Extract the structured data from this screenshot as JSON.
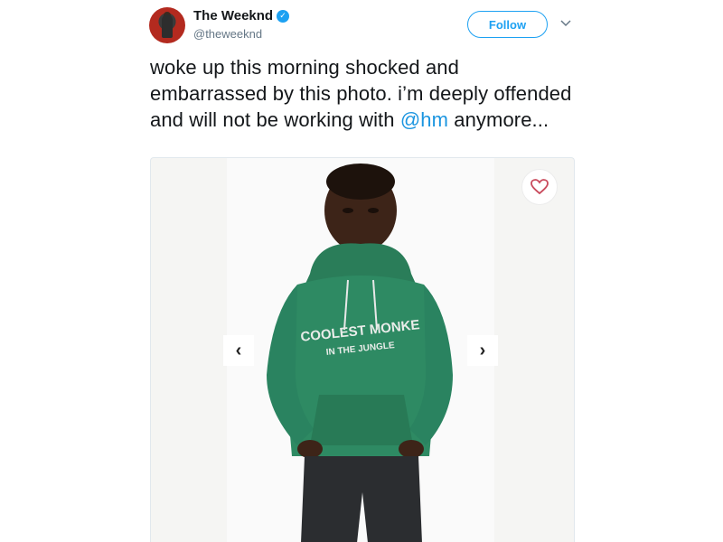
{
  "user": {
    "display_name": "The Weeknd",
    "handle": "@theweeknd",
    "verified": true
  },
  "actions": {
    "follow_label": "Follow"
  },
  "tweet": {
    "text_before": "woke up this morning shocked and embarrassed by this photo. i’m deeply offended and will not be working with ",
    "mention": "@hm",
    "text_after": " anymore..."
  },
  "media": {
    "prev_label": "‹",
    "next_label": "›",
    "hoodie_print_line1": "COOLEST MONKE",
    "hoodie_print_line2": "IN THE JUNGLE"
  },
  "colors": {
    "accent": "#1da1f2",
    "mention": "#1b95e0",
    "hoodie": "#2e8a63",
    "heart": "#c94a5c"
  }
}
